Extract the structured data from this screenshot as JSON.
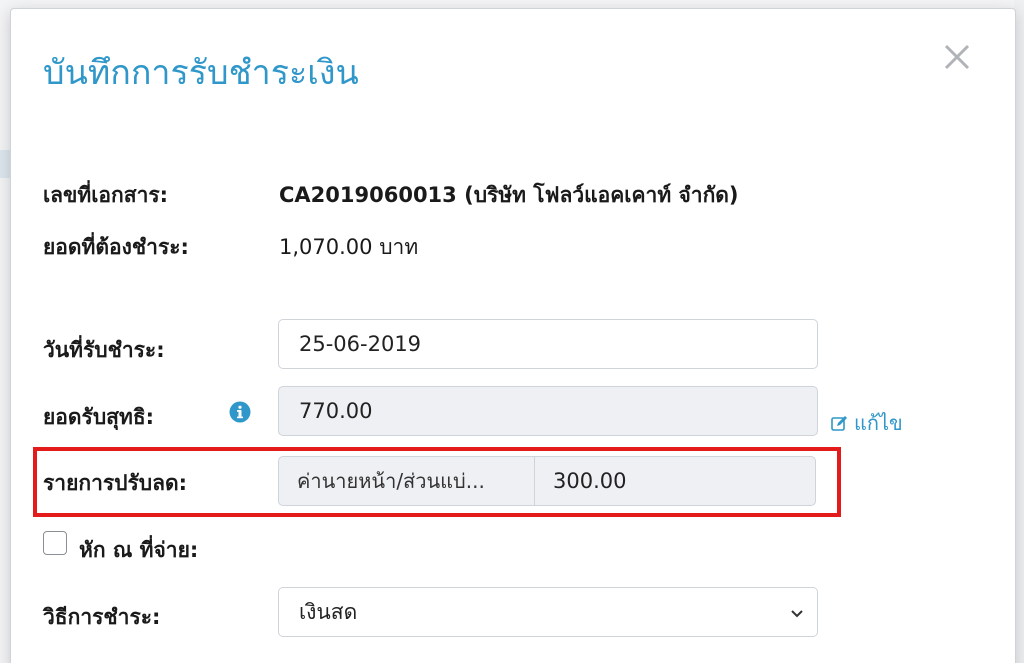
{
  "modal": {
    "title": "บันทึกการรับชำระเงิน"
  },
  "document": {
    "doc_no_label": "เลขที่เอกสาร:",
    "doc_no_value": "CA2019060013 (บริษัท โฟลว์แอคเคาท์ จำกัด)",
    "amount_due_label": "ยอดที่ต้องชำระ:",
    "amount_due_value": "1,070.00 บาท"
  },
  "form": {
    "payment_date_label": "วันที่รับชำระ:",
    "payment_date_value": "25-06-2019",
    "net_received_label": "ยอดรับสุทธิ:",
    "net_received_value": "770.00",
    "edit_label": "แก้ไข",
    "adjustment_label": "รายการปรับลด:",
    "adjustment_name": "ค่านายหน้า/ส่วนแบ่...",
    "adjustment_amount": "300.00",
    "withholding_label": "หัก ณ ที่จ่าย:",
    "withholding_checked": false,
    "method_label": "วิธีการชำระ:",
    "method_value": "เงินสด"
  },
  "colors": {
    "accent": "#2f97c9",
    "highlight": "#e41b1b"
  },
  "icons": {
    "close": "close-icon",
    "info": "info-icon",
    "edit": "edit-icon",
    "chevron": "chevron-down-icon"
  }
}
